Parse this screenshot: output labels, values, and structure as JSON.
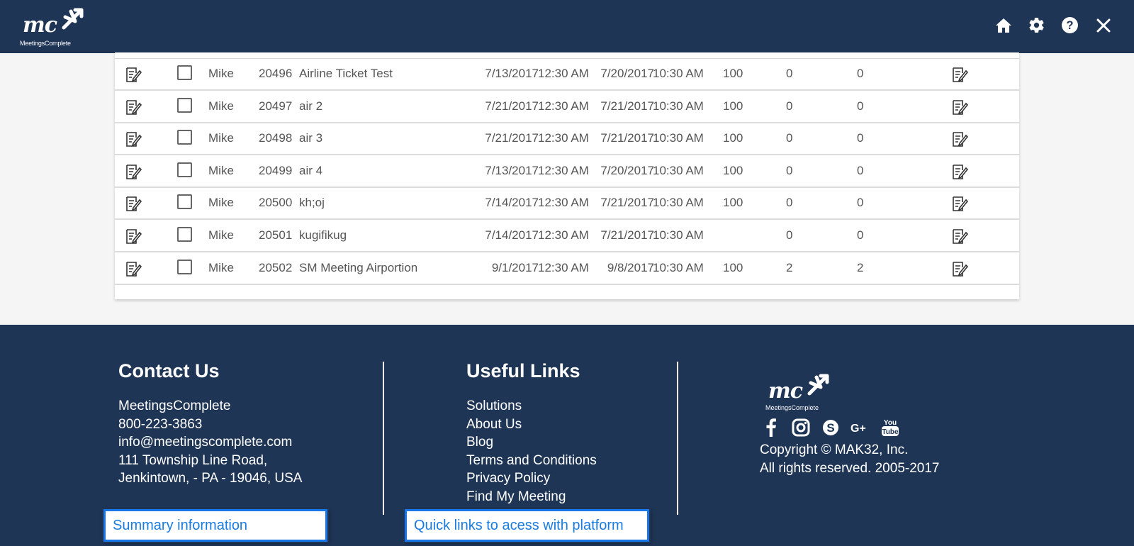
{
  "header": {
    "logo_text": "mc",
    "logo_subtext": "MeetingsComplete",
    "icons": [
      "home-icon",
      "gear-icon",
      "help-icon",
      "close-icon"
    ]
  },
  "rows": [
    {
      "owner": "Mike",
      "id": "20496",
      "name": "Airline Ticket Test",
      "start_date": "7/13/2017",
      "start_time": "12:30 AM",
      "end_date": "7/20/2017",
      "end_time": "10:30 AM",
      "capacity": "100",
      "c1": "0",
      "c2": "0"
    },
    {
      "owner": "Mike",
      "id": "20497",
      "name": "air 2",
      "start_date": "7/21/2017",
      "start_time": "12:30 AM",
      "end_date": "7/21/2017",
      "end_time": "10:30 AM",
      "capacity": "100",
      "c1": "0",
      "c2": "0"
    },
    {
      "owner": "Mike",
      "id": "20498",
      "name": "air 3",
      "start_date": "7/21/2017",
      "start_time": "12:30 AM",
      "end_date": "7/21/2017",
      "end_time": "10:30 AM",
      "capacity": "100",
      "c1": "0",
      "c2": "0"
    },
    {
      "owner": "Mike",
      "id": "20499",
      "name": "air 4",
      "start_date": "7/13/2017",
      "start_time": "12:30 AM",
      "end_date": "7/20/2017",
      "end_time": "10:30 AM",
      "capacity": "100",
      "c1": "0",
      "c2": "0"
    },
    {
      "owner": "Mike",
      "id": "20500",
      "name": "kh;oj",
      "start_date": "7/14/2017",
      "start_time": "12:30 AM",
      "end_date": "7/21/2017",
      "end_time": "10:30 AM",
      "capacity": "100",
      "c1": "0",
      "c2": "0"
    },
    {
      "owner": "Mike",
      "id": "20501",
      "name": "kugifikug",
      "start_date": "7/14/2017",
      "start_time": "12:30 AM",
      "end_date": "7/21/2017",
      "end_time": "10:30 AM",
      "capacity": "",
      "c1": "0",
      "c2": "0"
    },
    {
      "owner": "Mike",
      "id": "20502",
      "name": "SM Meeting Airportion",
      "start_date": "9/1/2017",
      "start_time": "12:30 AM",
      "end_date": "9/8/2017",
      "end_time": "10:30 AM",
      "capacity": "100",
      "c1": "2",
      "c2": "2"
    }
  ],
  "footer": {
    "contact": {
      "title": "Contact Us",
      "lines": [
        "MeetingsComplete",
        "800-223-3863",
        "info@meetingscomplete.com",
        "111 Township Line Road,",
        "Jenkintown, - PA - 19046, USA"
      ]
    },
    "links": {
      "title": "Useful Links",
      "items": [
        "Solutions",
        "About Us",
        "Blog",
        "Terms and Conditions",
        "Privacy Policy",
        "Find My Meeting"
      ]
    },
    "brand": {
      "logo_text": "mc",
      "logo_subtext": "MeetingsComplete",
      "social": [
        "facebook-icon",
        "instagram-icon",
        "skype-icon",
        "google-plus-icon",
        "youtube-icon"
      ],
      "copyright_line1": "Copyright © MAK32, Inc.",
      "copyright_line2": "All rights reserved. 2005-2017"
    }
  },
  "tooltips": {
    "summary": "Summary information",
    "quick_links": "Quick links to acess with platform"
  },
  "colors": {
    "navy": "#1f3556",
    "accent_blue": "#1976e8"
  }
}
